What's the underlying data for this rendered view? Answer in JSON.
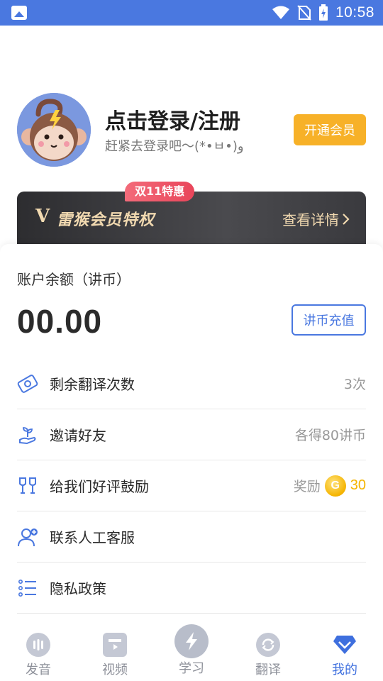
{
  "status_bar": {
    "time": "10:58"
  },
  "profile": {
    "title": "点击登录/注册",
    "subtitle": "赶紧去登录吧～(*•ㅂ•)و",
    "vip_button": "开通会员"
  },
  "banner": {
    "badge": "双11特惠",
    "logo": "V",
    "title": "雷猴会员特权",
    "details": "查看详情"
  },
  "balance": {
    "label": "账户余额（讲币）",
    "value": "00.00",
    "recharge_button": "讲币充值"
  },
  "menu": [
    {
      "label": "剩余翻译次数",
      "value": "3次",
      "icon": "ticket-icon"
    },
    {
      "label": "邀请好友",
      "value": "各得80讲币",
      "icon": "plant-hand-icon"
    },
    {
      "label": "给我们好评鼓励",
      "value": "奖励",
      "coin": "G",
      "reward": "30",
      "icon": "cheers-icon"
    },
    {
      "label": "联系人工客服",
      "value": "",
      "icon": "customer-service-icon"
    },
    {
      "label": "隐私政策",
      "value": "",
      "icon": "list-icon"
    }
  ],
  "tabs": [
    {
      "label": "发音",
      "icon": "pronunciation-icon",
      "active": false
    },
    {
      "label": "视频",
      "icon": "video-icon",
      "active": false
    },
    {
      "label": "学习",
      "icon": "lightning-icon",
      "active": false
    },
    {
      "label": "翻译",
      "icon": "translate-icon",
      "active": false
    },
    {
      "label": "我的",
      "icon": "diamond-icon",
      "active": true
    }
  ],
  "colors": {
    "primary": "#4a78e0",
    "vip_orange": "#f7b128",
    "banner_gold": "#f1d9b0",
    "badge_red": "#e9455a",
    "coin_gold": "#f5b400",
    "tab_active": "#3e6fde"
  }
}
